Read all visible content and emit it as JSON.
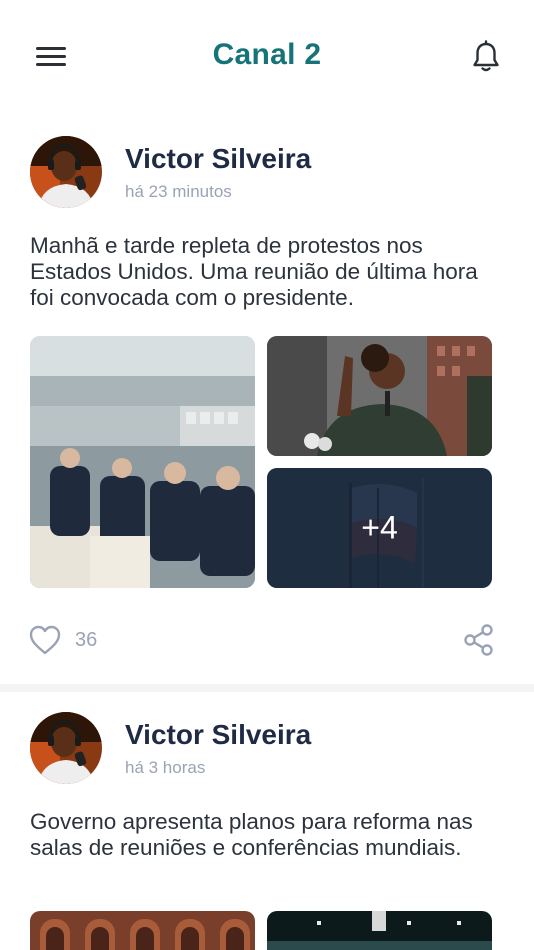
{
  "header": {
    "title": "Canal 2",
    "menu_icon": "menu-icon",
    "notification_icon": "bell-icon"
  },
  "colors": {
    "brand": "#16737a",
    "author": "#1f2a44",
    "muted": "#9aa3b5",
    "divider": "#f3f4f6"
  },
  "posts": [
    {
      "author": "Victor Silveira",
      "time": "há 23 minutos",
      "text": "Manhã e tarde repleta de protestos nos Estados Unidos. Uma reunião de última hora foi convocada com o presidente.",
      "more_images_label": "+4",
      "likes": "36",
      "like_icon": "heart-icon",
      "share_icon": "share-icon"
    },
    {
      "author": "Victor Silveira",
      "time": "há 3 horas",
      "text": "Governo apresenta planos para reforma nas salas de reuniões e conferências mundiais."
    }
  ]
}
